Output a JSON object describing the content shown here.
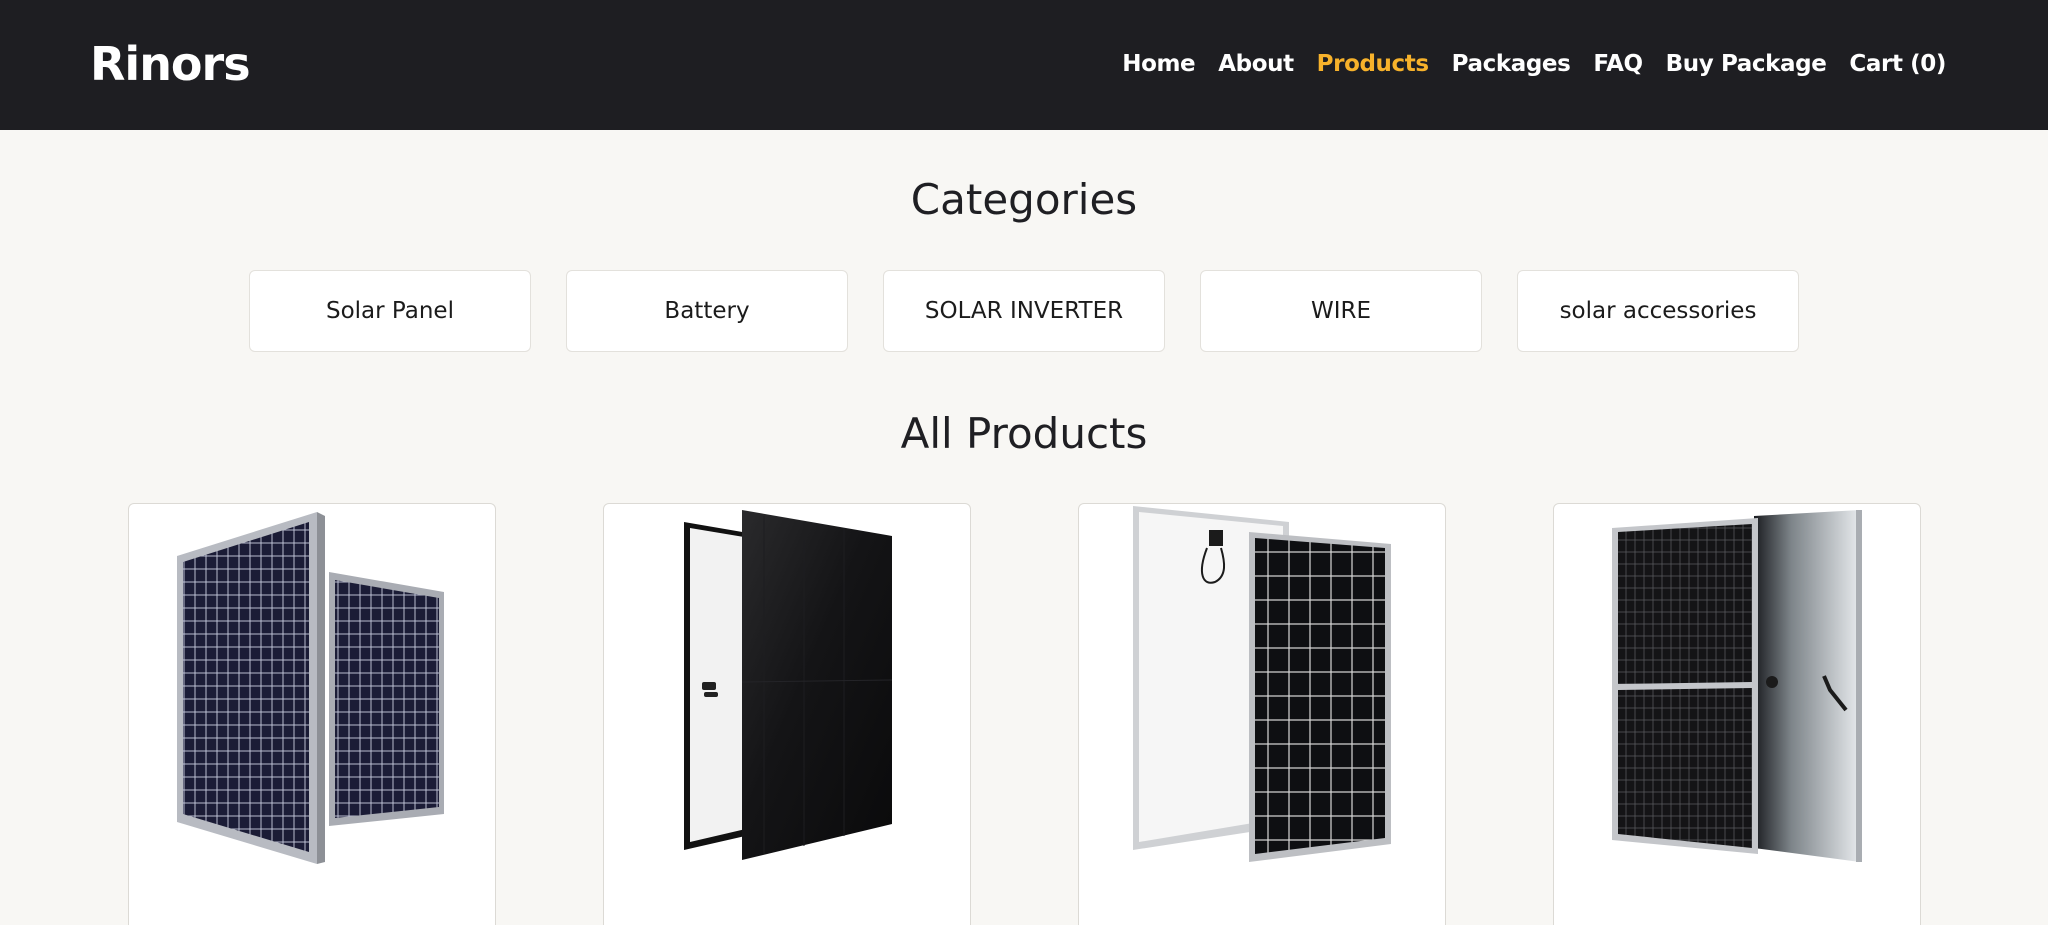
{
  "header": {
    "brand": "Rinors",
    "nav": [
      {
        "label": "Home",
        "active": false
      },
      {
        "label": "About",
        "active": false
      },
      {
        "label": "Products",
        "active": true
      },
      {
        "label": "Packages",
        "active": false
      },
      {
        "label": "FAQ",
        "active": false
      },
      {
        "label": "Buy Package",
        "active": false
      },
      {
        "label": "Cart (0)",
        "active": false
      }
    ]
  },
  "categories": {
    "title": "Categories",
    "items": [
      "Solar Panel",
      "Battery",
      "SOLAR INVERTER",
      "WIRE",
      "solar accessories"
    ]
  },
  "products": {
    "title": "All Products",
    "items": [
      {
        "image": "solar-panel-pair-blue-icon"
      },
      {
        "image": "black-solar-panel-pair-icon"
      },
      {
        "image": "white-back-solar-panel-icon"
      },
      {
        "image": "half-cell-solar-panel-icon"
      }
    ]
  },
  "colors": {
    "header_bg": "#1e1e22",
    "active_nav": "#f7b22b",
    "page_bg": "#f8f7f4",
    "text": "#1f1f23"
  }
}
